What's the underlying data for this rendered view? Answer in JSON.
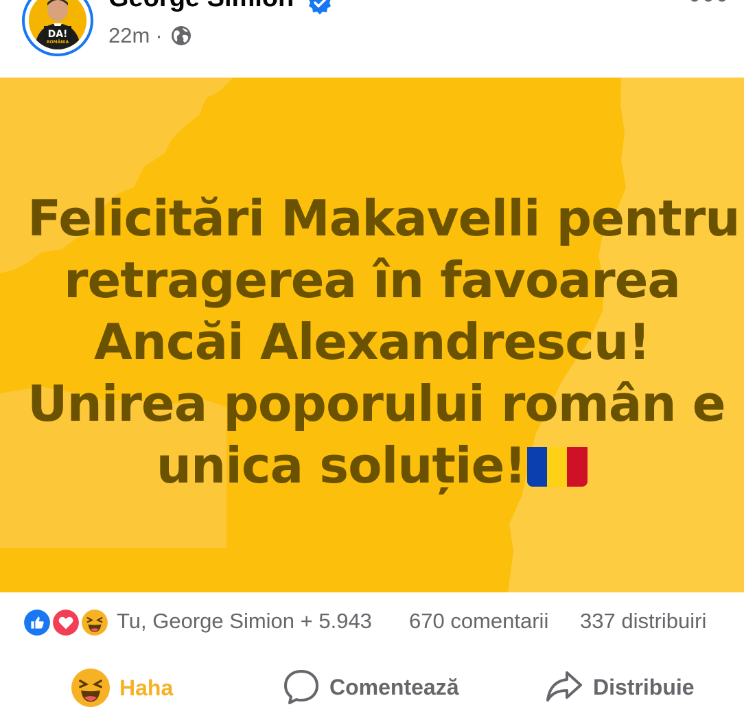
{
  "post": {
    "author": "George Simion",
    "verified": true,
    "time": "22m",
    "separator": "·",
    "audience_icon": "globe-icon",
    "avatar_badge": "DA!",
    "avatar_badge_sub": "ROMÂNIA"
  },
  "card": {
    "background_color": "#fbbf0c",
    "text_color": "#6b5200",
    "lines": [
      "Felicitări Makavelli pentru",
      "retragerea în favoarea",
      "Ancăi Alexandrescu!",
      "Unirea poporului român e",
      "unica soluție!"
    ],
    "emoji": "romania-flag-emoji"
  },
  "reactions": {
    "icons": [
      "like-icon",
      "love-icon",
      "haha-icon"
    ],
    "summary": "Tu, George Simion + 5.943",
    "comments": "670 comentarii",
    "shares": "337 distribuiri"
  },
  "actions": {
    "reaction_label": "Haha",
    "comment_label": "Comentează",
    "share_label": "Distribuie",
    "reaction_color": "#f7b125"
  }
}
